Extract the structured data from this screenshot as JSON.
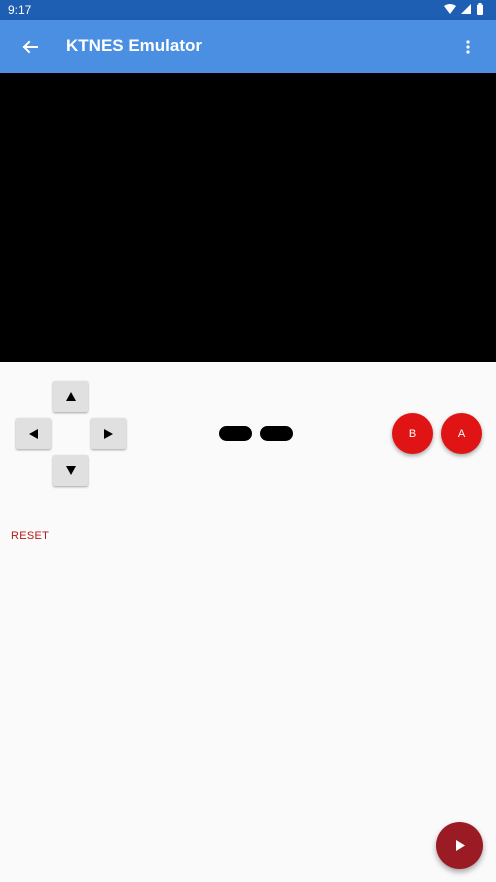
{
  "status_bar": {
    "time": "9:17",
    "icons": [
      "wifi-icon",
      "signal-icon",
      "battery-icon"
    ]
  },
  "app_bar": {
    "title": "KTNES Emulator",
    "back_icon": "arrow-back-icon",
    "menu_icon": "more-vert-icon",
    "color": "#4a8fe2"
  },
  "controller": {
    "dpad": {
      "up_icon": "triangle-up-icon",
      "left_icon": "triangle-left-icon",
      "right_icon": "triangle-right-icon",
      "down_icon": "triangle-down-icon"
    },
    "buttons": {
      "b_label": "B",
      "a_label": "A",
      "color": "#e01414"
    },
    "reset_label": "RESET"
  },
  "fab": {
    "icon": "play-icon",
    "color": "#9b1b24"
  }
}
